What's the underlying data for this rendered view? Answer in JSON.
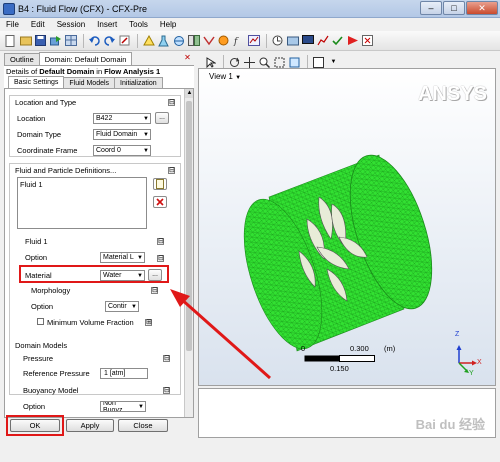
{
  "window": {
    "title": "B4 : Fluid Flow (CFX) - CFX-Pre",
    "minimize": "‒",
    "maximize": "□",
    "close": "✕"
  },
  "menu": [
    "File",
    "Edit",
    "Session",
    "Insert",
    "Tools",
    "Help"
  ],
  "panel": {
    "tabs": [
      "Outline",
      "Domain: Default Domain"
    ],
    "close_glyph": "✕",
    "details_prefix": "Details of",
    "details_object": "Default Domain",
    "details_in": "in",
    "details_context": "Flow Analysis 1",
    "inner_tabs": [
      "Basic Settings",
      "Fluid Models",
      "Initialization"
    ]
  },
  "form": {
    "location_type_header": "Location and Type",
    "location_label": "Location",
    "location_value": "B422",
    "domain_type_label": "Domain Type",
    "domain_type_value": "Fluid Domain",
    "coord_frame_label": "Coordinate Frame",
    "coord_frame_value": "Coord 0",
    "fluid_defs_header": "Fluid and Particle Definitions...",
    "fluid_list": [
      "Fluid 1"
    ],
    "fluid1_header": "Fluid 1",
    "option_label": "Option",
    "option_value": "Material L",
    "material_label": "Material",
    "material_value": "Water",
    "ellipsis": "...",
    "morphology_header": "Morphology",
    "morph_option_label": "Option",
    "morph_option_value": "Contir",
    "min_volume_label": "Minimum Volume Fraction",
    "domain_models_header": "Domain Models",
    "pressure_header": "Pressure",
    "ref_pressure_label": "Reference Pressure",
    "ref_pressure_value": "1 [atm]",
    "buoyancy_header": "Buoyancy Model",
    "buoyancy_option_label": "Option",
    "buoyancy_option_value": "Non Buoyz",
    "minus": "⊟",
    "plus": "⊞"
  },
  "buttons": {
    "ok": "OK",
    "apply": "Apply",
    "close": "Close"
  },
  "view": {
    "label": "View 1",
    "logo": "ANSYS",
    "scale_ticks": [
      "0",
      "0.300",
      "0.150"
    ],
    "scale_unit": "(m)",
    "axes": {
      "x": "X",
      "y": "Y",
      "z": "Z"
    }
  },
  "watermark": "Bai du 经验"
}
